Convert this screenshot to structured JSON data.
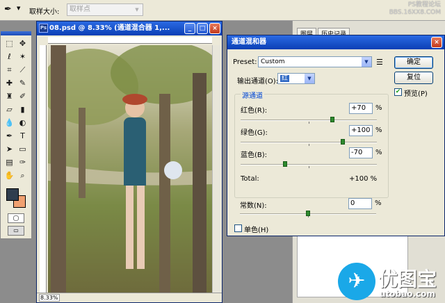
{
  "options_bar": {
    "tool_icon": "eyedropper-icon",
    "sample_size_label": "取样大小:",
    "sample_size_value": "取样点",
    "watermark_line1": "PS教程论坛",
    "watermark_line2": "BBS.16XX8.COM"
  },
  "toolbox": {
    "tools": [
      "marquee",
      "move",
      "lasso",
      "magic-wand",
      "crop",
      "slice",
      "healing",
      "brush",
      "stamp",
      "history-brush",
      "eraser",
      "gradient",
      "blur",
      "dodge",
      "pen",
      "type",
      "path-select",
      "shape",
      "notes",
      "eyedropper",
      "hand",
      "zoom"
    ],
    "foreground_color": "#2f3d4e",
    "background_color": "#f0a070"
  },
  "document": {
    "title": "08.psd @ 8.33% (通道混合器 1,...",
    "zoom": "8.33%"
  },
  "panels": {
    "tabs": [
      "图层",
      "历史记录"
    ]
  },
  "channel_mixer": {
    "title": "通道混和器",
    "preset_label": "Preset:",
    "preset_value": "Custom",
    "output_label": "输出通道(O):",
    "output_value": "红",
    "ok_label": "确定",
    "reset_label": "复位",
    "preview_label": "预览(P)",
    "preview_checked": true,
    "source_group_label": "源通道",
    "channels": [
      {
        "label": "红色(R):",
        "value": "+70",
        "pct": "%",
        "level": 70
      },
      {
        "label": "绿色(G):",
        "value": "+100",
        "pct": "%",
        "level": 100
      },
      {
        "label": "蓝色(B):",
        "value": "-70",
        "pct": "%",
        "level": -70
      }
    ],
    "total_label": "Total:",
    "total_value": "+100 %",
    "constant_label": "常数(N):",
    "constant_value": "0",
    "constant_pct": "%",
    "constant_level": 0,
    "mono_label": "单色(H)",
    "mono_checked": false
  },
  "logo": {
    "text": "优图宝",
    "url": "utobao.com"
  }
}
